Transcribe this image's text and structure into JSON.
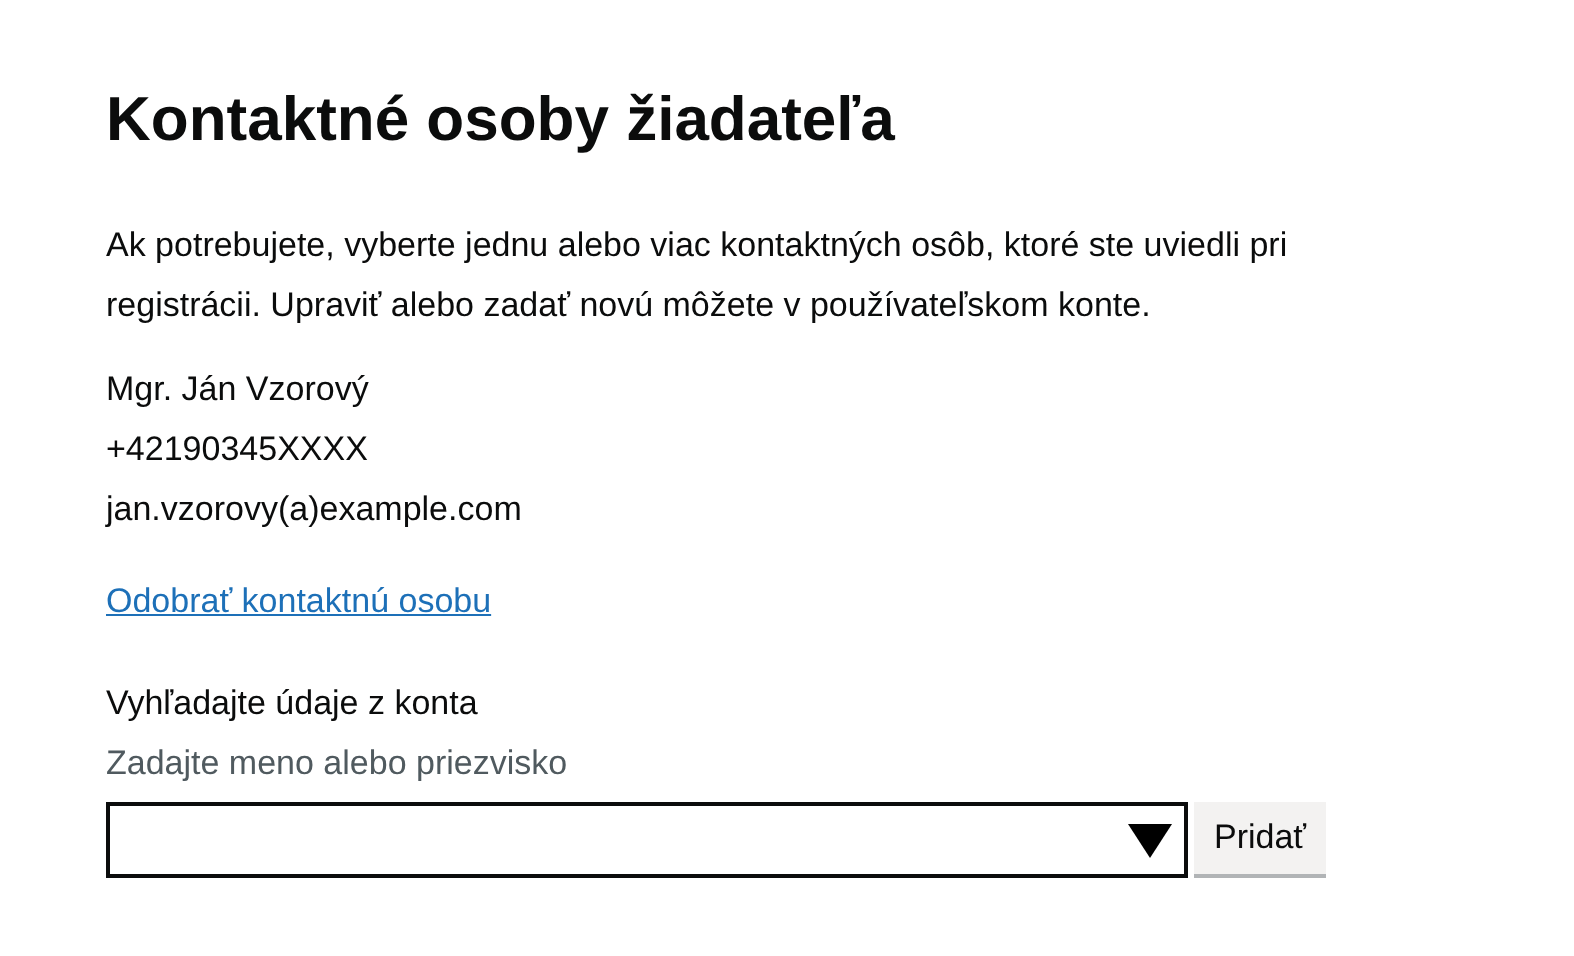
{
  "heading": "Kontaktné osoby žiadateľa",
  "intro": "Ak potrebujete, vyberte jednu alebo viac kontaktných osôb, ktoré ste uviedli pri registrácii. Upraviť alebo zadať novú môžete v používateľskom konte.",
  "contact": [
    "Mgr. Ján Vzorový",
    "+42190345XXXX",
    "jan.vzorovy(a)example.com"
  ],
  "remove_link": "Odobrať kontaktnú osobu",
  "search": {
    "label": "Vyhľadajte údaje z konta",
    "hint": "Zadajte meno alebo priezvisko"
  },
  "add_button": "Pridať"
}
